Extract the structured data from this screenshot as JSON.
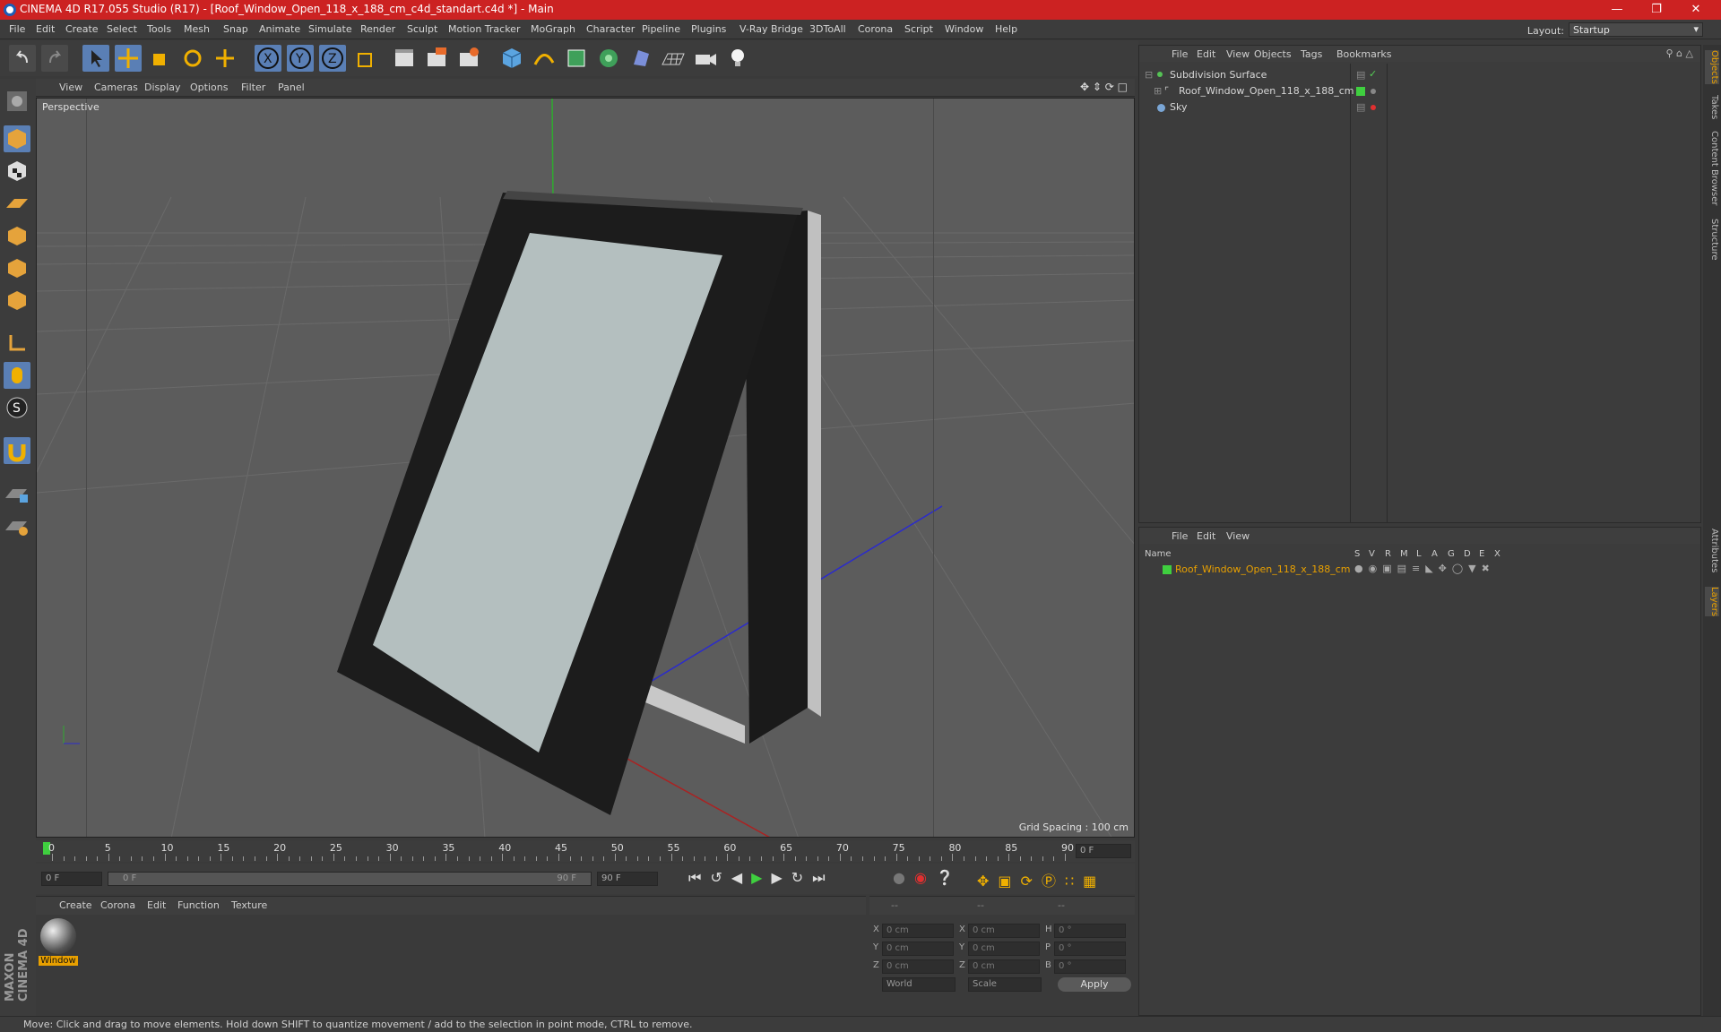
{
  "title": "CINEMA 4D R17.055 Studio (R17) - [Roof_Window_Open_118_x_188_cm_c4d_standart.c4d *] - Main",
  "menus": [
    "File",
    "Edit",
    "Create",
    "Select",
    "Tools",
    "Mesh",
    "Snap",
    "Animate",
    "Simulate",
    "Render",
    "Sculpt",
    "Motion Tracker",
    "MoGraph",
    "Character",
    "Pipeline",
    "Plugins",
    "V-Ray Bridge",
    "3DToAll",
    "Corona",
    "Script",
    "Window",
    "Help"
  ],
  "layout": {
    "label": "Layout:",
    "value": "Startup"
  },
  "viewport": {
    "menus": [
      "View",
      "Cameras",
      "Display",
      "Options",
      "Filter",
      "Panel"
    ],
    "label": "Perspective",
    "grid_spacing": "Grid Spacing : 100 cm"
  },
  "timeline": {
    "ticks": [
      "0",
      "5",
      "10",
      "15",
      "20",
      "25",
      "30",
      "35",
      "40",
      "45",
      "50",
      "55",
      "60",
      "65",
      "70",
      "75",
      "80",
      "85",
      "90"
    ],
    "end_field": "0 F"
  },
  "playback": {
    "start": "0 F",
    "range_start": "0 F",
    "range_end": "90 F",
    "end": "90 F"
  },
  "material": {
    "menus": [
      "Create",
      "Corona",
      "Edit",
      "Function",
      "Texture"
    ],
    "items": [
      {
        "name": "Window"
      }
    ]
  },
  "coords": {
    "headers": [
      "--",
      "--",
      "--"
    ],
    "rows": [
      {
        "a": "X",
        "a_val": "0 cm",
        "b": "X",
        "b_val": "0 cm",
        "c": "H",
        "c_val": "0 °"
      },
      {
        "a": "Y",
        "a_val": "0 cm",
        "b": "Y",
        "b_val": "0 cm",
        "c": "P",
        "c_val": "0 °"
      },
      {
        "a": "Z",
        "a_val": "0 cm",
        "b": "Z",
        "b_val": "0 cm",
        "c": "B",
        "c_val": "0 °"
      }
    ],
    "world": "World",
    "scale": "Scale",
    "apply": "Apply"
  },
  "objects": {
    "menus": [
      "File",
      "Edit",
      "View",
      "Objects",
      "Tags",
      "Bookmarks"
    ],
    "items": [
      {
        "name": "Subdivision Surface",
        "color": "#55c255"
      },
      {
        "name": "Roof_Window_Open_118_x_188_cm",
        "color": "#55c255"
      },
      {
        "name": "Sky",
        "color": "#7aa6d6"
      }
    ]
  },
  "layers": {
    "menus": [
      "File",
      "Edit",
      "View"
    ],
    "columns": [
      "Name",
      "S",
      "V",
      "R",
      "M",
      "L",
      "A",
      "G",
      "D",
      "E",
      "X"
    ],
    "items": [
      {
        "name": "Roof_Window_Open_118_x_188_cm",
        "color": "#e8a000"
      }
    ]
  },
  "side_tabs": [
    "Objects",
    "Takes",
    "Content Browser",
    "Structure",
    "Attributes",
    "Layers"
  ],
  "status": "Move: Click and drag to move elements. Hold down SHIFT to quantize movement / add to the selection in point mode, CTRL to remove.",
  "brand": "MAXON CINEMA 4D"
}
